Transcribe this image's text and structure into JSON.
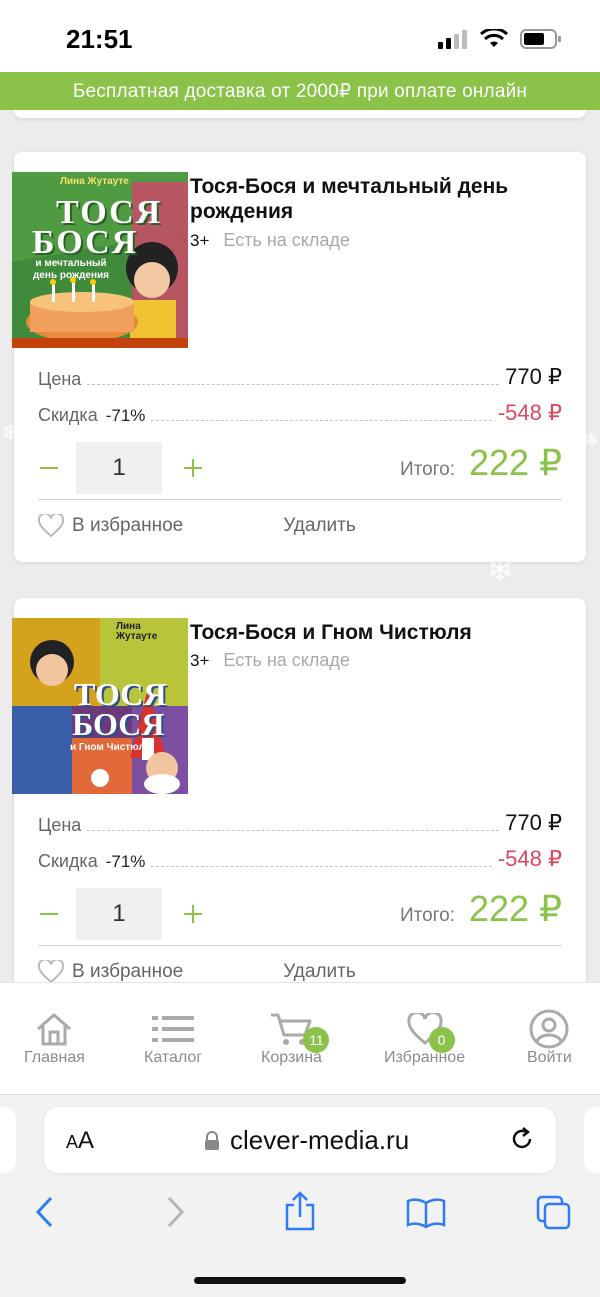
{
  "status": {
    "time": "21:51"
  },
  "promo": {
    "text": "Бесплатная доставка от 2000₽ при оплате онлайн"
  },
  "cart_items": [
    {
      "title": "Тося-Бося и мечтальный день рождения",
      "age": "3+",
      "stock": "Есть на складе",
      "cover": {
        "author": "Лина Жутауте",
        "title_lines": [
          "ТОСЯ",
          "БОСЯ"
        ],
        "subtitle": "и мечтальный день рождения"
      },
      "price_label": "Цена",
      "price": "770 ₽",
      "discount_label": "Скидка",
      "discount_pct": "-71%",
      "discount": "-548 ₽",
      "quantity": "1",
      "total_label": "Итого:",
      "total": "222 ₽",
      "favorite_label": "В избранное",
      "delete_label": "Удалить"
    },
    {
      "title": "Тося-Бося и Гном Чистюля",
      "age": "3+",
      "stock": "Есть на складе",
      "cover": {
        "author": "Лина Жутауте",
        "title_lines": [
          "ТОСЯ",
          "БОСЯ"
        ],
        "subtitle": "и Гном Чистюля"
      },
      "price_label": "Цена",
      "price": "770 ₽",
      "discount_label": "Скидка",
      "discount_pct": "-71%",
      "discount": "-548 ₽",
      "quantity": "1",
      "total_label": "Итого:",
      "total": "222 ₽",
      "favorite_label": "В избранное",
      "delete_label": "Удалить"
    }
  ],
  "bottom_nav": {
    "items": [
      {
        "label": "Главная",
        "icon": "home-icon"
      },
      {
        "label": "Каталог",
        "icon": "list-icon"
      },
      {
        "label": "Корзина",
        "icon": "cart-icon",
        "badge": "11"
      },
      {
        "label": "Избранное",
        "icon": "heart-icon",
        "badge": "0"
      },
      {
        "label": "Войти",
        "icon": "user-icon"
      }
    ]
  },
  "browser": {
    "text_size": "AA",
    "url": "clever-media.ru"
  },
  "colors": {
    "accent": "#8bc34a",
    "discount": "#e0475c"
  }
}
